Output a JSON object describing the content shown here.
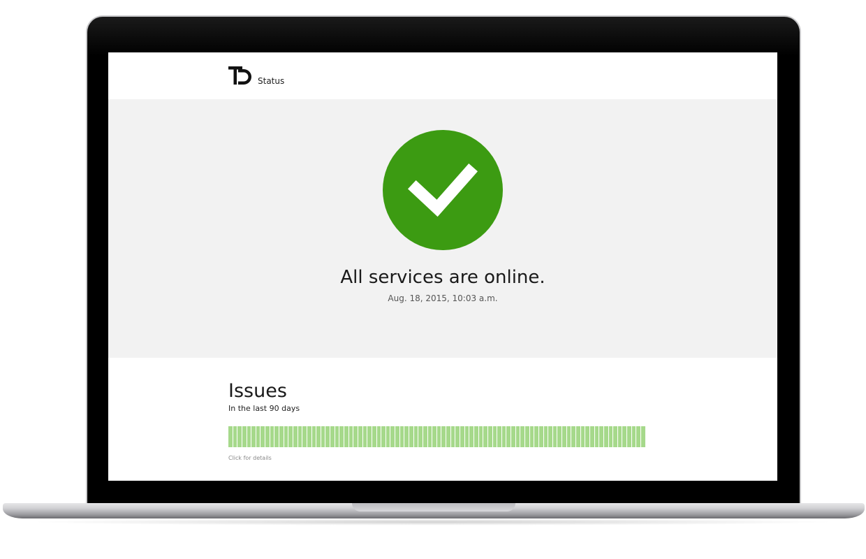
{
  "header": {
    "logo_icon": "td-logo-icon",
    "title": "Status"
  },
  "hero": {
    "status_icon": "checkmark-icon",
    "status_color": "#3c9b12",
    "title": "All services are online.",
    "timestamp": "Aug. 18, 2015, 10:03 a.m."
  },
  "issues": {
    "title": "Issues",
    "subtitle": "In the last 90 days",
    "day_count": 90,
    "day_status": "operational",
    "day_color": "#a6d98b",
    "hint": "Click for details"
  }
}
